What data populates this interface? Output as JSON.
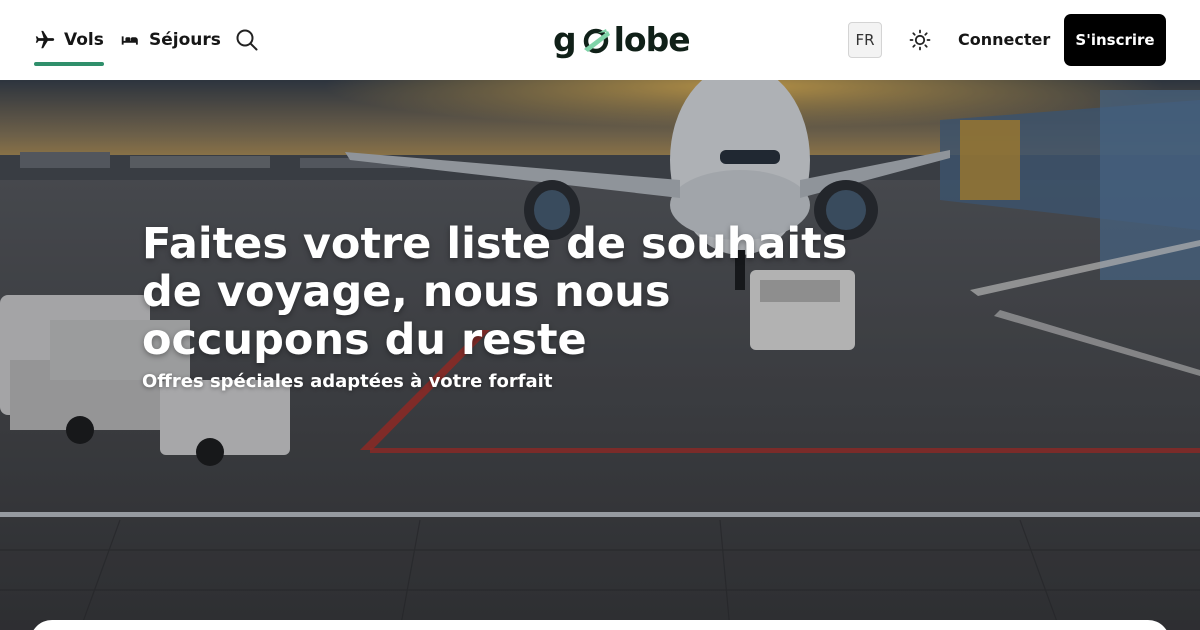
{
  "header": {
    "nav": [
      {
        "label": "Vols",
        "icon": "airplane-icon",
        "active": true
      },
      {
        "label": "Séjours",
        "icon": "bed-icon",
        "active": false
      }
    ],
    "search_icon": "search-icon",
    "logo_text_start": "g",
    "logo_text_end": "lobe",
    "language": "FR",
    "theme_icon": "sun-icon",
    "login_label": "Connecter",
    "signup_label": "S'inscrire"
  },
  "hero": {
    "title": "Faites votre liste de souhaits de voyage, nous nous occupons du reste",
    "subtitle": "Offres spéciales adaptées à votre forfait"
  },
  "colors": {
    "accent": "#2f8f6b",
    "logo_green": "#7fd3a8",
    "dark": "#102018",
    "button": "#000000"
  }
}
